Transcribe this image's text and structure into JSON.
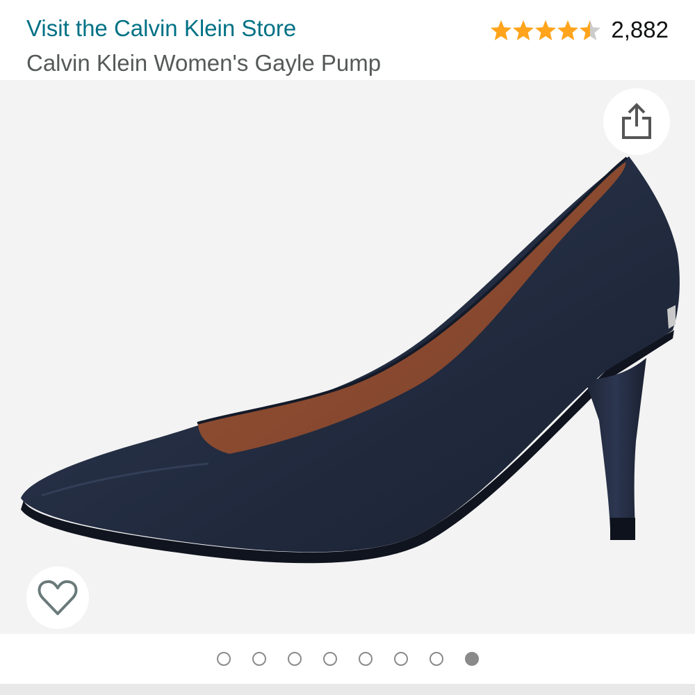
{
  "header": {
    "store_link": "Visit the Calvin Klein Store",
    "product_title": "Calvin Klein Women's Gayle Pump"
  },
  "rating": {
    "stars": 4.5,
    "max_stars": 5,
    "review_count": "2,882",
    "star_color": "#ffa41c",
    "empty_star_color": "#cccccc"
  },
  "gallery": {
    "image_alt": "Navy leather pointed-toe pump with stiletto heel",
    "share_icon": "share-icon",
    "wishlist_icon": "heart-icon",
    "image_count": 8,
    "active_index": 7
  },
  "colors": {
    "link": "#007185",
    "title": "#565959",
    "gallery_bg": "#f3f3f3",
    "shoe_navy": "#253047",
    "shoe_lining": "#8a4a32"
  }
}
